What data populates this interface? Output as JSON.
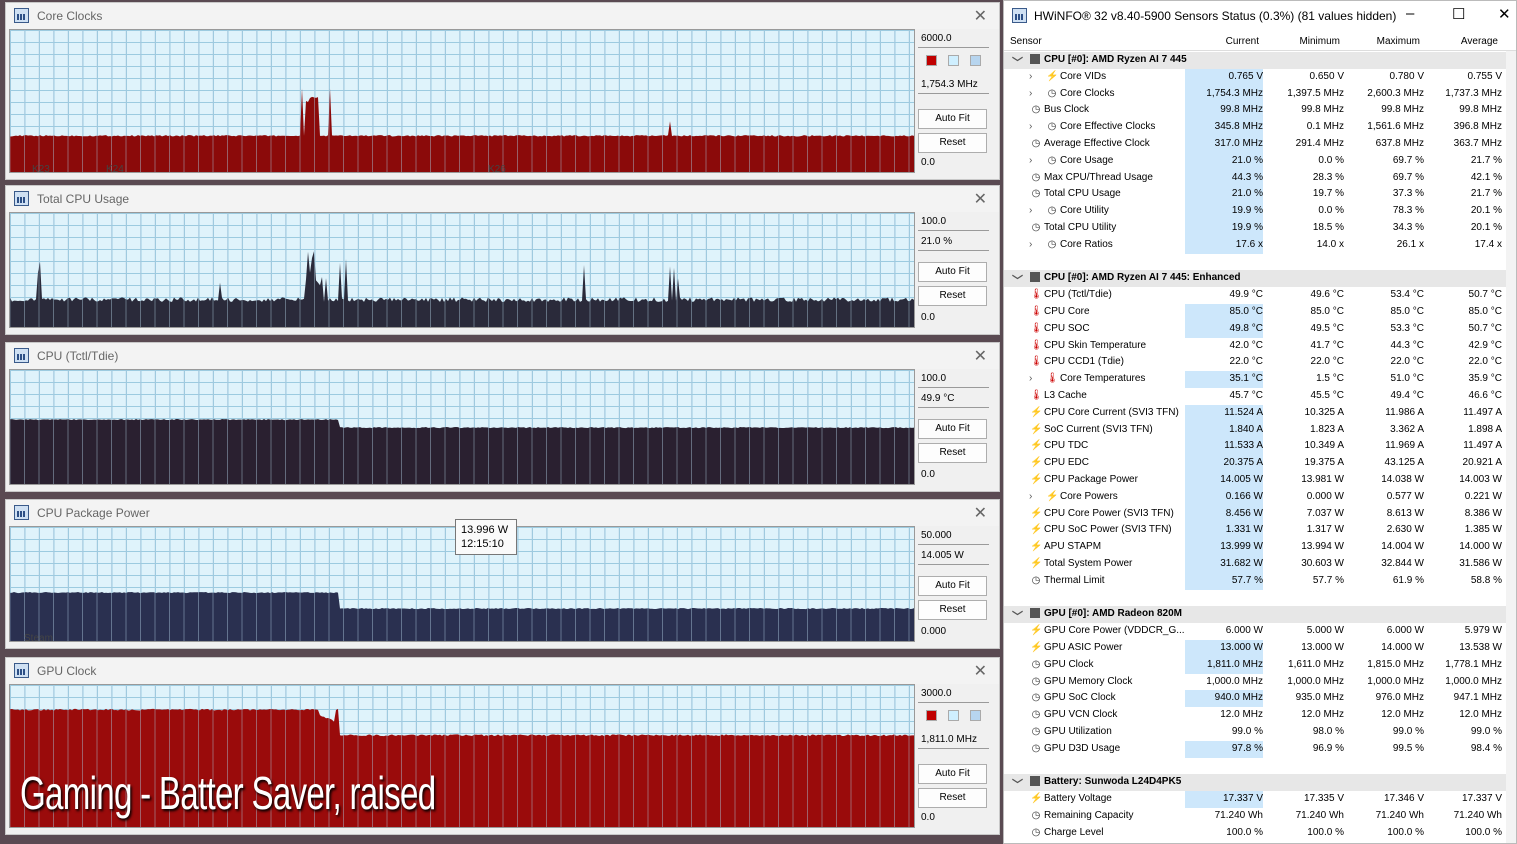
{
  "graphs": [
    {
      "id": "core-clocks",
      "title": "Core Clocks",
      "max": "6000.0",
      "current": "1,754.3 MHz",
      "min": "0.0",
      "autofit": "Auto Fit",
      "reset": "Reset",
      "swatches": [
        "#c00000",
        "#cfefff",
        "#b7d5ef"
      ],
      "color": "#8b0a0a",
      "xlabels": [
        "K23",
        "K24",
        "K26"
      ]
    },
    {
      "id": "total-cpu-usage",
      "title": "Total CPU Usage",
      "max": "100.0",
      "current": "21.0 %",
      "min": "0.0",
      "autofit": "Auto Fit",
      "reset": "Reset",
      "color": "#2a2a3a"
    },
    {
      "id": "cpu-tctl",
      "title": "CPU (Tctl/Tdie)",
      "max": "100.0",
      "current": "49.9 °C",
      "min": "0.0",
      "autofit": "Auto Fit",
      "reset": "Reset",
      "color": "#2a2030"
    },
    {
      "id": "cpu-package-power",
      "title": "CPU Package Power",
      "max": "50.000",
      "current": "14.005 W",
      "min": "0.000",
      "autofit": "Auto Fit",
      "reset": "Reset",
      "color": "#2a3050",
      "xlabels": [
        "Steam"
      ]
    },
    {
      "id": "gpu-clock",
      "title": "GPU Clock",
      "max": "3000.0",
      "current": "1,811.0 MHz",
      "min": "0.0",
      "autofit": "Auto Fit",
      "reset": "Reset",
      "swatches": [
        "#c00000",
        "#cfefff",
        "#b7d5ef"
      ],
      "color": "#9a0b0b"
    }
  ],
  "tooltip": {
    "value": "13.996 W",
    "time": "12:15:10"
  },
  "overlay_caption": "Gaming - Batter Saver, raised",
  "hwinfo": {
    "title": "HWiNFO® 32 v8.40-5900 Sensors Status (0.3%) (81 values hidden)",
    "columns": [
      "Sensor",
      "Current",
      "Minimum",
      "Maximum",
      "Average"
    ],
    "rows": [
      {
        "type": "group",
        "name": "CPU [#0]: AMD Ryzen AI 7 445"
      },
      {
        "type": "sub",
        "icon": "bolt",
        "expand": true,
        "name": "Core VIDs",
        "cur": "0.765 V",
        "min": "0.650 V",
        "max": "0.780 V",
        "avg": "0.755 V",
        "hl": true
      },
      {
        "type": "sub",
        "icon": "clock",
        "expand": true,
        "name": "Core Clocks",
        "cur": "1,754.3 MHz",
        "min": "1,397.5 MHz",
        "max": "2,600.3 MHz",
        "avg": "1,737.3 MHz",
        "hl": true
      },
      {
        "type": "item",
        "icon": "clock",
        "name": "Bus Clock",
        "cur": "99.8 MHz",
        "min": "99.8 MHz",
        "max": "99.8 MHz",
        "avg": "99.8 MHz",
        "hl": true
      },
      {
        "type": "sub",
        "icon": "clock",
        "expand": true,
        "name": "Core Effective Clocks",
        "cur": "345.8 MHz",
        "min": "0.1 MHz",
        "max": "1,561.6 MHz",
        "avg": "396.8 MHz",
        "hl": true
      },
      {
        "type": "item",
        "icon": "clock",
        "name": "Average Effective Clock",
        "cur": "317.0 MHz",
        "min": "291.4 MHz",
        "max": "637.8 MHz",
        "avg": "363.7 MHz",
        "hl": true
      },
      {
        "type": "sub",
        "icon": "clock",
        "expand": true,
        "name": "Core Usage",
        "cur": "21.0 %",
        "min": "0.0 %",
        "max": "69.7 %",
        "avg": "21.7 %",
        "hl": true
      },
      {
        "type": "item",
        "icon": "clock",
        "name": "Max CPU/Thread Usage",
        "cur": "44.3 %",
        "min": "28.3 %",
        "max": "69.7 %",
        "avg": "42.1 %",
        "hl": true
      },
      {
        "type": "item",
        "icon": "clock",
        "name": "Total CPU Usage",
        "cur": "21.0 %",
        "min": "19.7 %",
        "max": "37.3 %",
        "avg": "21.7 %",
        "hl": true
      },
      {
        "type": "sub",
        "icon": "clock",
        "expand": true,
        "name": "Core Utility",
        "cur": "19.9 %",
        "min": "0.0 %",
        "max": "78.3 %",
        "avg": "20.1 %",
        "hl": true
      },
      {
        "type": "item",
        "icon": "clock",
        "name": "Total CPU Utility",
        "cur": "19.9 %",
        "min": "18.5 %",
        "max": "34.3 %",
        "avg": "20.1 %",
        "hl": true
      },
      {
        "type": "sub",
        "icon": "clock",
        "expand": true,
        "name": "Core Ratios",
        "cur": "17.6 x",
        "min": "14.0 x",
        "max": "26.1 x",
        "avg": "17.4 x",
        "hl": true
      },
      {
        "type": "blank"
      },
      {
        "type": "group",
        "name": "CPU [#0]: AMD Ryzen AI 7 445: Enhanced"
      },
      {
        "type": "item",
        "icon": "temp",
        "name": "CPU (Tctl/Tdie)",
        "cur": "49.9 °C",
        "min": "49.6 °C",
        "max": "53.4 °C",
        "avg": "50.7 °C",
        "hl": false
      },
      {
        "type": "item",
        "icon": "temp",
        "name": "CPU Core",
        "cur": "85.0 °C",
        "min": "85.0 °C",
        "max": "85.0 °C",
        "avg": "85.0 °C",
        "hl": true
      },
      {
        "type": "item",
        "icon": "temp",
        "name": "CPU SOC",
        "cur": "49.8 °C",
        "min": "49.5 °C",
        "max": "53.3 °C",
        "avg": "50.7 °C",
        "hl": true
      },
      {
        "type": "item",
        "icon": "temp",
        "name": "CPU Skin Temperature",
        "cur": "42.0 °C",
        "min": "41.7 °C",
        "max": "44.3 °C",
        "avg": "42.9 °C",
        "hl": false
      },
      {
        "type": "item",
        "icon": "temp",
        "name": "CPU CCD1 (Tdie)",
        "cur": "22.0 °C",
        "min": "22.0 °C",
        "max": "22.0 °C",
        "avg": "22.0 °C",
        "hl": false
      },
      {
        "type": "sub",
        "icon": "temp",
        "expand": true,
        "name": "Core Temperatures",
        "cur": "35.1 °C",
        "min": "1.5 °C",
        "max": "51.0 °C",
        "avg": "35.9 °C",
        "hl": true
      },
      {
        "type": "item",
        "icon": "temp",
        "name": "L3 Cache",
        "cur": "45.7 °C",
        "min": "45.5 °C",
        "max": "49.4 °C",
        "avg": "46.6 °C",
        "hl": false
      },
      {
        "type": "item",
        "icon": "bolt",
        "name": "CPU Core Current (SVI3 TFN)",
        "cur": "11.524 A",
        "min": "10.325 A",
        "max": "11.986 A",
        "avg": "11.497 A",
        "hl": true
      },
      {
        "type": "item",
        "icon": "bolt",
        "name": "SoC Current (SVI3 TFN)",
        "cur": "1.840 A",
        "min": "1.823 A",
        "max": "3.362 A",
        "avg": "1.898 A",
        "hl": true
      },
      {
        "type": "item",
        "icon": "bolt",
        "name": "CPU TDC",
        "cur": "11.533 A",
        "min": "10.349 A",
        "max": "11.969 A",
        "avg": "11.497 A",
        "hl": true
      },
      {
        "type": "item",
        "icon": "bolt",
        "name": "CPU EDC",
        "cur": "20.375 A",
        "min": "19.375 A",
        "max": "43.125 A",
        "avg": "20.921 A",
        "hl": true
      },
      {
        "type": "item",
        "icon": "bolt",
        "name": "CPU Package Power",
        "cur": "14.005 W",
        "min": "13.981 W",
        "max": "14.038 W",
        "avg": "14.003 W",
        "hl": true
      },
      {
        "type": "sub",
        "icon": "bolt",
        "expand": true,
        "name": "Core Powers",
        "cur": "0.166 W",
        "min": "0.000 W",
        "max": "0.577 W",
        "avg": "0.221 W",
        "hl": true
      },
      {
        "type": "item",
        "icon": "bolt",
        "name": "CPU Core Power (SVI3 TFN)",
        "cur": "8.456 W",
        "min": "7.037 W",
        "max": "8.613 W",
        "avg": "8.386 W",
        "hl": true
      },
      {
        "type": "item",
        "icon": "bolt",
        "name": "CPU SoC Power (SVI3 TFN)",
        "cur": "1.331 W",
        "min": "1.317 W",
        "max": "2.630 W",
        "avg": "1.385 W",
        "hl": true
      },
      {
        "type": "item",
        "icon": "bolt",
        "name": "APU STAPM",
        "cur": "13.999 W",
        "min": "13.994 W",
        "max": "14.004 W",
        "avg": "14.000 W",
        "hl": true
      },
      {
        "type": "item",
        "icon": "bolt",
        "name": "Total System Power",
        "cur": "31.682 W",
        "min": "30.603 W",
        "max": "32.844 W",
        "avg": "31.586 W",
        "hl": true
      },
      {
        "type": "item",
        "icon": "clock",
        "name": "Thermal Limit",
        "cur": "57.7 %",
        "min": "57.7 %",
        "max": "61.9 %",
        "avg": "58.8 %",
        "hl": true
      },
      {
        "type": "blank"
      },
      {
        "type": "group",
        "name": "GPU [#0]: AMD Radeon 820M"
      },
      {
        "type": "item",
        "icon": "bolt",
        "name": "GPU Core Power (VDDCR_G...",
        "cur": "6.000 W",
        "min": "5.000 W",
        "max": "6.000 W",
        "avg": "5.979 W",
        "hl": false
      },
      {
        "type": "item",
        "icon": "bolt",
        "name": "GPU ASIC Power",
        "cur": "13.000 W",
        "min": "13.000 W",
        "max": "14.000 W",
        "avg": "13.538 W",
        "hl": true
      },
      {
        "type": "item",
        "icon": "clock",
        "name": "GPU Clock",
        "cur": "1,811.0 MHz",
        "min": "1,611.0 MHz",
        "max": "1,815.0 MHz",
        "avg": "1,778.1 MHz",
        "hl": true
      },
      {
        "type": "item",
        "icon": "clock",
        "name": "GPU Memory Clock",
        "cur": "1,000.0 MHz",
        "min": "1,000.0 MHz",
        "max": "1,000.0 MHz",
        "avg": "1,000.0 MHz",
        "hl": false
      },
      {
        "type": "item",
        "icon": "clock",
        "name": "GPU SoC Clock",
        "cur": "940.0 MHz",
        "min": "935.0 MHz",
        "max": "976.0 MHz",
        "avg": "947.1 MHz",
        "hl": true
      },
      {
        "type": "item",
        "icon": "clock",
        "name": "GPU VCN Clock",
        "cur": "12.0 MHz",
        "min": "12.0 MHz",
        "max": "12.0 MHz",
        "avg": "12.0 MHz",
        "hl": false
      },
      {
        "type": "item",
        "icon": "clock",
        "name": "GPU Utilization",
        "cur": "99.0 %",
        "min": "98.0 %",
        "max": "99.0 %",
        "avg": "99.0 %",
        "hl": false
      },
      {
        "type": "item",
        "icon": "clock",
        "name": "GPU D3D Usage",
        "cur": "97.8 %",
        "min": "96.9 %",
        "max": "99.5 %",
        "avg": "98.4 %",
        "hl": true
      },
      {
        "type": "blank"
      },
      {
        "type": "group",
        "name": "Battery: Sunwoda L24D4PK5"
      },
      {
        "type": "item",
        "icon": "bolt",
        "name": "Battery Voltage",
        "cur": "17.337 V",
        "min": "17.335 V",
        "max": "17.346 V",
        "avg": "17.337 V",
        "hl": true
      },
      {
        "type": "item",
        "icon": "clock",
        "name": "Remaining Capacity",
        "cur": "71.240 Wh",
        "min": "71.240 Wh",
        "max": "71.240 Wh",
        "avg": "71.240 Wh",
        "hl": false
      },
      {
        "type": "item",
        "icon": "clock",
        "name": "Charge Level",
        "cur": "100.0 %",
        "min": "100.0 %",
        "max": "100.0 %",
        "avg": "100.0 %",
        "hl": false
      }
    ]
  }
}
